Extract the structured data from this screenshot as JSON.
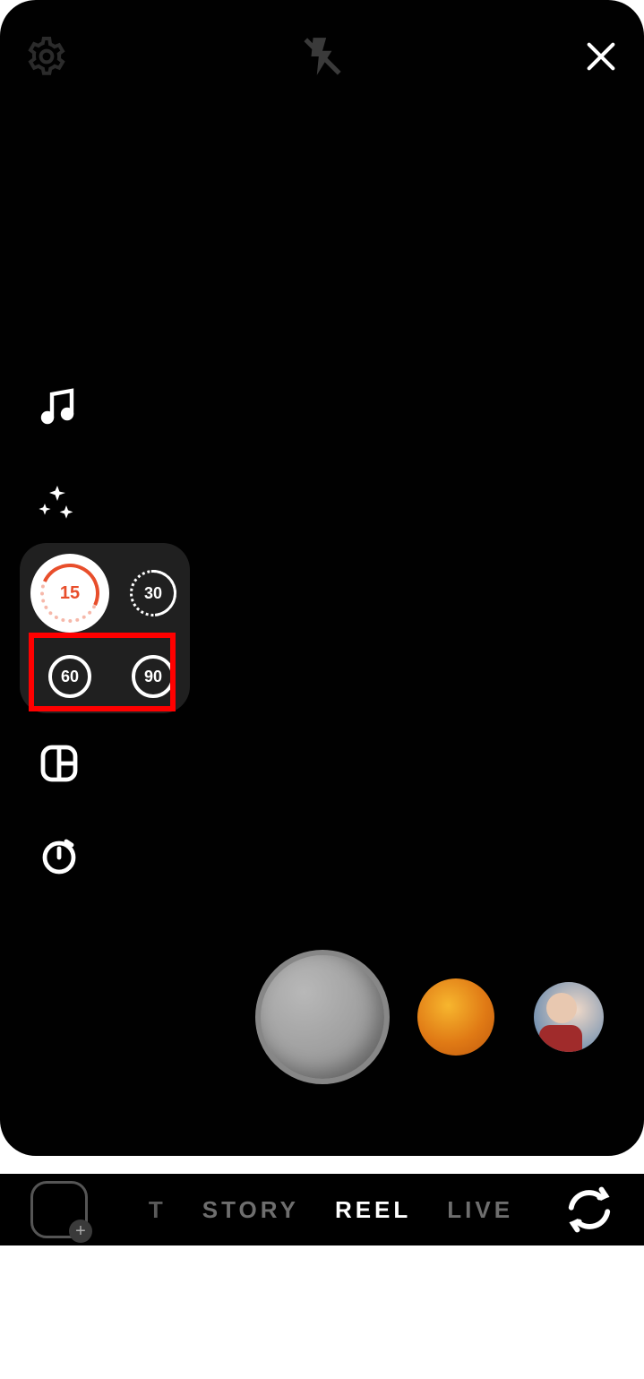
{
  "top": {
    "settings": "settings",
    "flash": "flash-off",
    "close": "close"
  },
  "tools": {
    "music": "music",
    "effects": "effects",
    "layout": "layout",
    "timer": "timer"
  },
  "duration": {
    "opt1": "15",
    "opt2": "30",
    "opt3": "60",
    "opt4": "90"
  },
  "modes": {
    "prev_partial": "T",
    "story": "STORY",
    "reel": "REEL",
    "live": "LIVE"
  },
  "bottom": {
    "add": "+",
    "switch": "switch-camera"
  }
}
